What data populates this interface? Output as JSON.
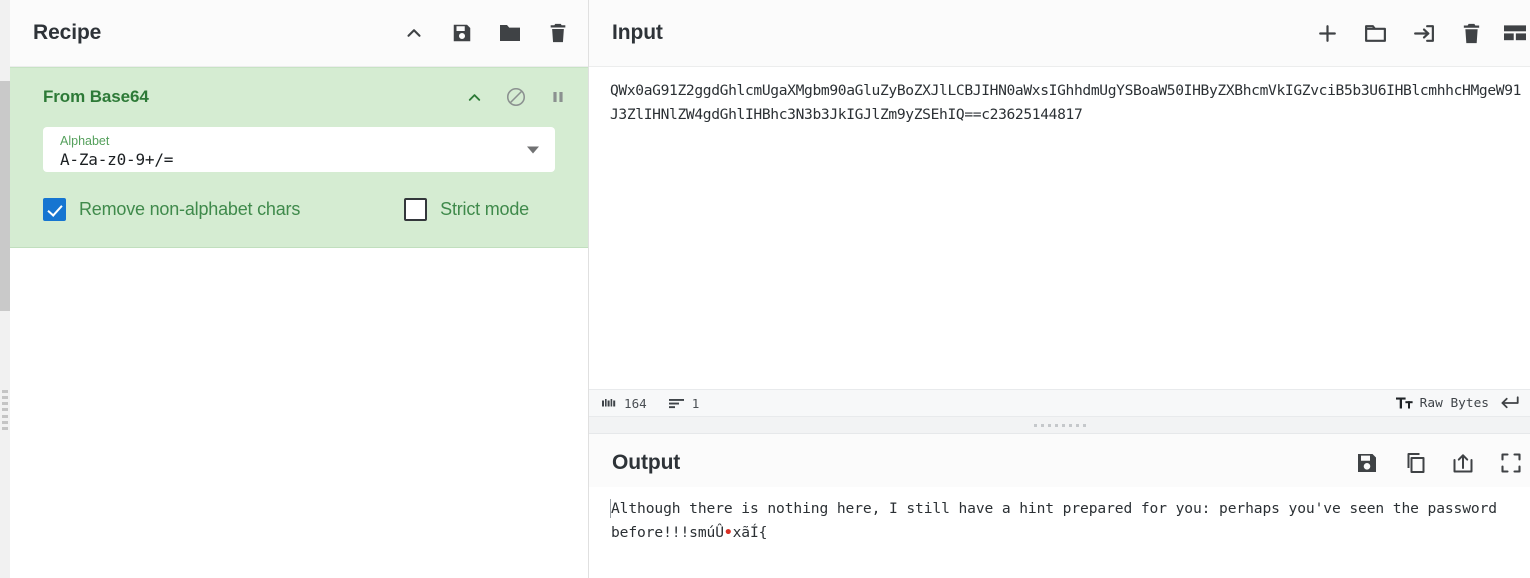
{
  "app": "CyberChef",
  "recipe": {
    "title": "Recipe",
    "tools": [
      {
        "name": "collapse-recipe",
        "icon": "chevron-up-icon",
        "label": "Collapse"
      },
      {
        "name": "save-recipe",
        "icon": "floppy-disk-icon",
        "label": "Save recipe"
      },
      {
        "name": "load-recipe",
        "icon": "folder-icon",
        "label": "Load recipe"
      },
      {
        "name": "clear-recipe",
        "icon": "trash-icon",
        "label": "Clear recipe"
      }
    ],
    "operations": [
      {
        "name": "From Base64",
        "tools": [
          {
            "name": "collapse-operation",
            "icon": "chevron-up-icon"
          },
          {
            "name": "disable-operation",
            "icon": "circle-slash-icon"
          },
          {
            "name": "set-breakpoint",
            "icon": "pause-icon"
          }
        ],
        "args": {
          "alphabet_label": "Alphabet",
          "alphabet_value": "A-Za-z0-9+/=",
          "remove_non_alphabet_label": "Remove non-alphabet chars",
          "remove_non_alphabet_checked": true,
          "strict_mode_label": "Strict mode",
          "strict_mode_checked": false
        }
      }
    ]
  },
  "input": {
    "title": "Input",
    "tools": [
      {
        "name": "add-input-tab",
        "icon": "plus-icon"
      },
      {
        "name": "open-folder-as-input",
        "icon": "folder-icon"
      },
      {
        "name": "open-file-as-input",
        "icon": "arrow-into-box-icon"
      },
      {
        "name": "clear-input",
        "icon": "trash-icon"
      },
      {
        "name": "input-tabs-layout",
        "icon": "panel-layout-icon"
      }
    ],
    "text": "QWx0aG91Z2ggdGhlcmUgaXMgbm90aGluZyBoZXJlLCBJIHN0aWxsIGhhdmUgYSBoaW50IHByZXBhcmVkIGZvciB5b3U6IHBlcmhhcHMgeW91J3ZlIHNlZW4gdGhlIHBhc3N3b3JkIGJlZm9yZSEhIQ==c23625144817",
    "status": {
      "length_icon": "abc-icon",
      "length": "164",
      "lines_icon": "lines-icon",
      "lines": "1",
      "encoding_icon": "font-size-icon",
      "encoding": "Raw Bytes",
      "line_ending_icon": "return-arrow-icon"
    }
  },
  "output": {
    "title": "Output",
    "tools": [
      {
        "name": "save-output",
        "icon": "floppy-disk-icon"
      },
      {
        "name": "copy-output",
        "icon": "copy-icon"
      },
      {
        "name": "replace-input-with-output",
        "icon": "upload-box-icon"
      },
      {
        "name": "maximise-output",
        "icon": "fullscreen-icon"
      }
    ],
    "text_before": "Although there is nothing here, I still have a hint prepared for you: perhaps you've seen the password before!!!smúÛ",
    "text_bullet": "•",
    "text_after": "xãÍ{"
  },
  "colors": {
    "operation_bg": "#d5ecd2",
    "operation_title": "#2d7a37",
    "checkbox_accent": "#1675d1",
    "label_green": "#3f8a4b",
    "arg_label_green": "#55a05c",
    "text_dark": "#2e3338",
    "control_char": "#d93025"
  }
}
